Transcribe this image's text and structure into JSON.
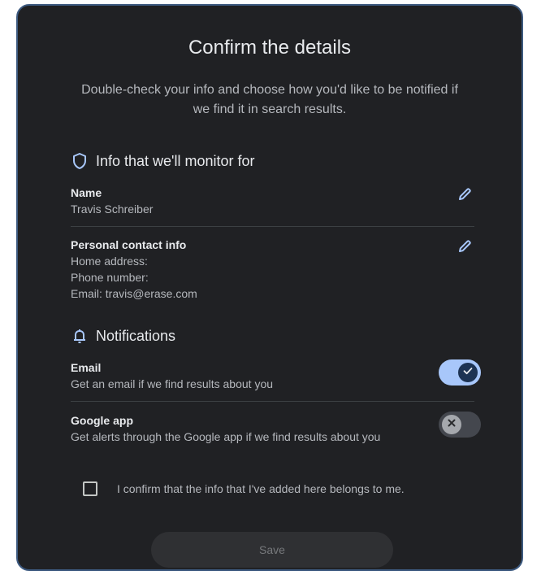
{
  "dialog": {
    "title": "Confirm the details",
    "subtitle": "Double-check your info and choose how you'd like to be notified if we find it in search results."
  },
  "monitor_section": {
    "heading": "Info that we'll monitor for",
    "icon": "shield-icon",
    "name_item": {
      "title": "Name",
      "value": "Travis Schreiber",
      "edit_icon": "pencil-icon"
    },
    "contact_item": {
      "title": "Personal contact info",
      "home_address": "Home address:",
      "phone_number": "Phone number:",
      "email": "Email: travis@erase.com",
      "edit_icon": "pencil-icon"
    }
  },
  "notifications_section": {
    "heading": "Notifications",
    "icon": "bell-icon",
    "email": {
      "title": "Email",
      "description": "Get an email if we find results about you",
      "enabled": true
    },
    "google_app": {
      "title": "Google app",
      "description": "Get alerts through the Google app if we find results about you",
      "enabled": false
    }
  },
  "confirm": {
    "label": "I confirm that the info that I've added here belongs to me.",
    "checked": false
  },
  "save_button": {
    "label": "Save",
    "enabled": false
  },
  "colors": {
    "background": "#202124",
    "accent": "#a8c7fa",
    "text_primary": "#e8eaed",
    "text_secondary": "#b5b8bd"
  }
}
